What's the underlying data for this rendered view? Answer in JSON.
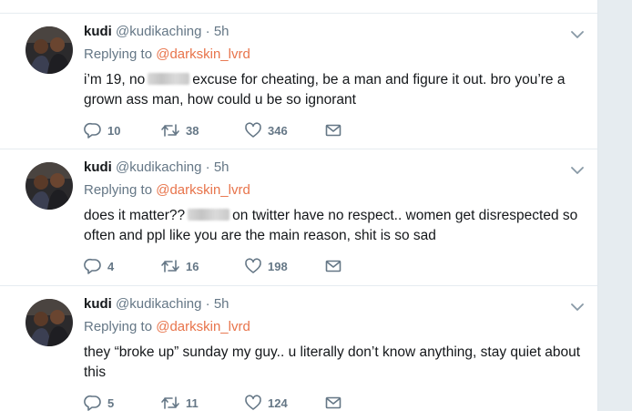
{
  "tweets": [
    {
      "name": "kudi",
      "handle": "@kudikaching",
      "dot": "·",
      "time": "5h",
      "replying_prefix": "Replying to",
      "replying_to": "@darkskin_lvrd",
      "text_before": "i’m 19, no",
      "text_after": "excuse for cheating, be a man and figure it out. bro you’re a grown ass man, how could u be so ignorant",
      "replies": "10",
      "retweets": "38",
      "likes": "346"
    },
    {
      "name": "kudi",
      "handle": "@kudikaching",
      "dot": "·",
      "time": "5h",
      "replying_prefix": "Replying to",
      "replying_to": "@darkskin_lvrd",
      "text_before": "does it matter??",
      "text_after": "on twitter have no respect.. women get disrespected so often and ppl like you are the main reason, shit is so sad",
      "replies": "4",
      "retweets": "16",
      "likes": "198"
    },
    {
      "name": "kudi",
      "handle": "@kudikaching",
      "dot": "·",
      "time": "5h",
      "replying_prefix": "Replying to",
      "replying_to": "@darkskin_lvrd",
      "text_before": "they “broke up” sunday my guy.. u literally don’t know anything, stay quiet about this",
      "text_after": "",
      "replies": "5",
      "retweets": "11",
      "likes": "124"
    }
  ],
  "colors": {
    "link": "#e8744b",
    "muted": "#657786",
    "text": "#14171a",
    "divider": "#e6ecf0"
  },
  "icons": [
    "chevron-down-icon",
    "reply-icon",
    "retweet-icon",
    "heart-icon",
    "envelope-icon"
  ]
}
